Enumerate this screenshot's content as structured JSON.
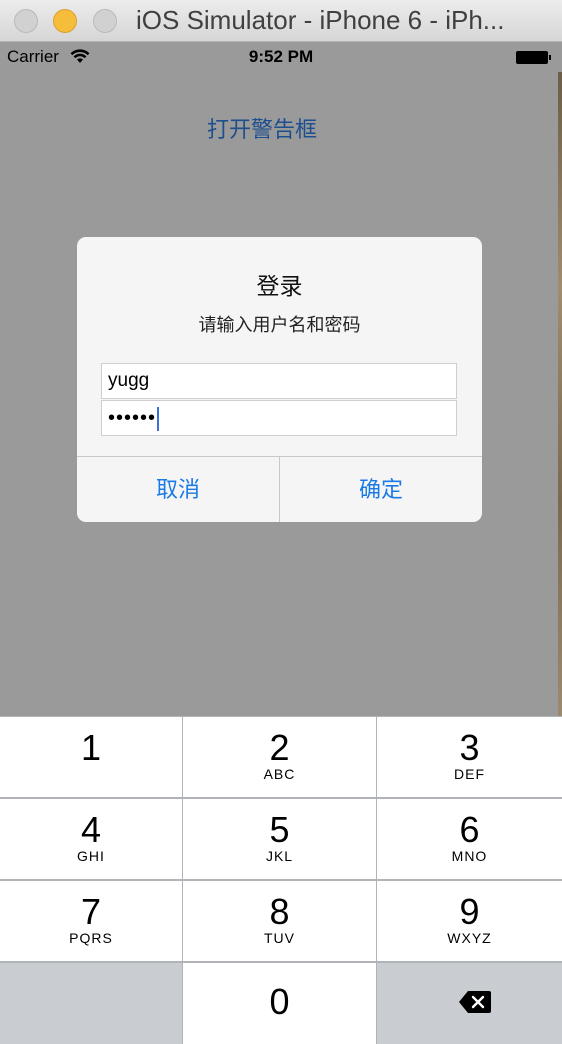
{
  "window": {
    "title": "iOS Simulator - iPhone 6 - iPh..."
  },
  "status_bar": {
    "carrier": "Carrier",
    "time": "9:52 PM"
  },
  "main": {
    "open_alert_label": "打开警告框"
  },
  "alert": {
    "title": "登录",
    "message": "请输入用户名和密码",
    "username_value": "yugg",
    "password_value": "••••••",
    "cancel_label": "取消",
    "confirm_label": "确定"
  },
  "keypad": {
    "keys": [
      {
        "num": "1",
        "letters": ""
      },
      {
        "num": "2",
        "letters": "ABC"
      },
      {
        "num": "3",
        "letters": "DEF"
      },
      {
        "num": "4",
        "letters": "GHI"
      },
      {
        "num": "5",
        "letters": "JKL"
      },
      {
        "num": "6",
        "letters": "MNO"
      },
      {
        "num": "7",
        "letters": "PQRS"
      },
      {
        "num": "8",
        "letters": "TUV"
      },
      {
        "num": "9",
        "letters": "WXYZ"
      },
      {
        "num": "0",
        "letters": ""
      }
    ]
  },
  "colors": {
    "accent": "#1a7ae6",
    "dim_background": "#9a9a9a"
  },
  "icons": [
    "wifi-icon",
    "battery-icon",
    "delete-backspace-icon"
  ]
}
